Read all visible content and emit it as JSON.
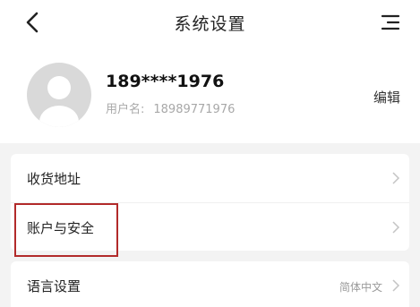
{
  "header": {
    "title": "系统设置",
    "back_icon": "chevron-left-icon",
    "menu_icon": "menu-lines-icon"
  },
  "profile": {
    "phone": "189****1976",
    "username_label": "用户名:",
    "username_value": "18989771976",
    "edit_label": "编辑"
  },
  "settings": {
    "items": [
      {
        "label": "收货地址",
        "value": ""
      },
      {
        "label": "账户与安全",
        "value": ""
      },
      {
        "label": "语言设置",
        "value": "简体中文"
      }
    ]
  },
  "colors": {
    "highlight": "#b22a2a",
    "background": "#f3f3f3",
    "card": "#ffffff"
  }
}
